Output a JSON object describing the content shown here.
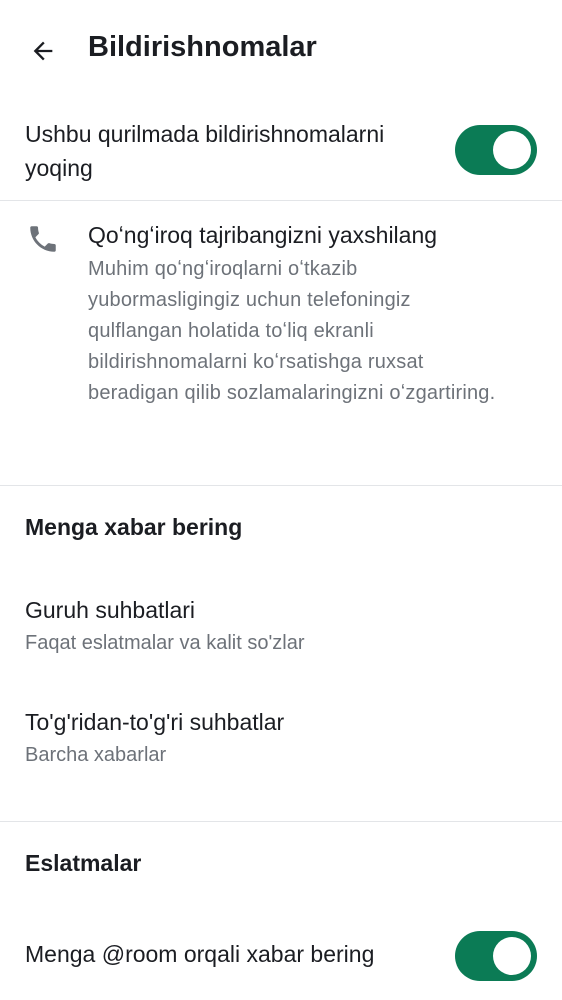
{
  "header": {
    "back_icon": "arrow-left-icon",
    "title": "Bildirishnomalar"
  },
  "enable_notifications": {
    "label": "Ushbu qurilmada bildirishnomalarni yoqing",
    "enabled": true
  },
  "call_tip": {
    "icon": "phone-icon",
    "title": "Qoʻngʻiroq tajribangizni yaxshilang",
    "description": "Muhim qoʻngʻiroqlarni oʻtkazib yubormasligingiz uchun telefoningiz qulflangan holatida toʻliq ekranli bildirishnomalarni koʻrsatishga ruxsat beradigan qilib sozlamalaringizni oʻzgartiring."
  },
  "notify_me": {
    "header": "Menga xabar bering",
    "group_chats": {
      "label": "Guruh suhbatlari",
      "value": "Faqat eslatmalar va kalit so'zlar"
    },
    "direct_chats": {
      "label": "To'g'ridan-to'g'ri suhbatlar",
      "value": "Barcha xabarlar"
    }
  },
  "mentions": {
    "header": "Eslatmalar",
    "room_label": "Menga @room orqali xabar bering",
    "room_enabled": true
  },
  "colors": {
    "accent": "#0b7b55",
    "text_primary": "#1b1d22",
    "text_secondary": "#6d7279",
    "divider": "#e3e5e8"
  }
}
